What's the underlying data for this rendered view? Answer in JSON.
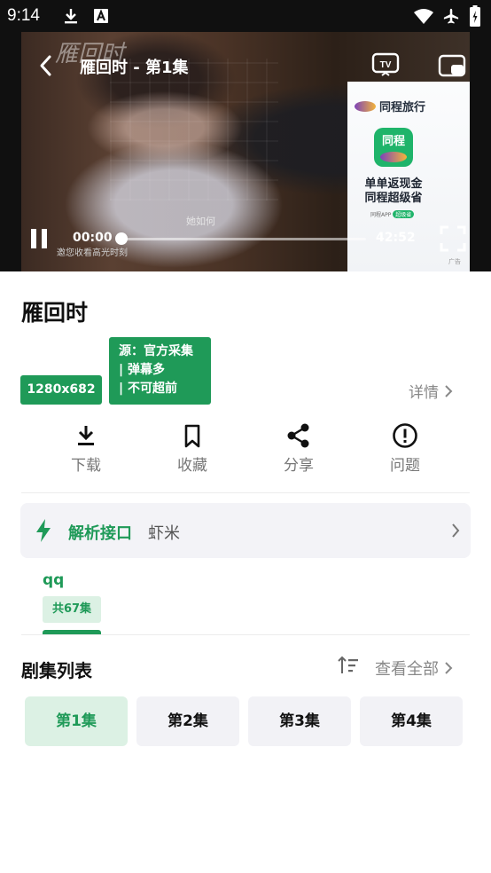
{
  "status_bar": {
    "time": "9:14",
    "icons": [
      "download-icon",
      "a-icon",
      "wifi-icon",
      "airplane-icon",
      "battery-icon"
    ]
  },
  "player": {
    "title": "雁回时 - 第1集",
    "current_time": "00:00",
    "duration": "42:52",
    "progress": 0.01,
    "subtitle": "她如何",
    "hint": "邀您收看高光时刻",
    "watermark": "雁回时"
  },
  "ad": {
    "brand": "同程旅行",
    "logo_text": "同程",
    "line1": "单单返现金",
    "line2": "同程超级省",
    "foot": "同程APP",
    "foot_pill": "超级省",
    "tag": "广告"
  },
  "show": {
    "title": "雁回时",
    "resolution": "1280x682",
    "source_lines": [
      "源：官方采集",
      "| 弹幕多",
      "| 不可超前"
    ],
    "details_label": "详情"
  },
  "actions": [
    {
      "label": "下载",
      "icon": "download-icon"
    },
    {
      "label": "收藏",
      "icon": "bookmark-icon"
    },
    {
      "label": "分享",
      "icon": "share-icon"
    },
    {
      "label": "问题",
      "icon": "alert-icon"
    }
  ],
  "parser": {
    "label": "解析接口",
    "value": "虾米"
  },
  "source": {
    "name": "qq",
    "count": "共67集"
  },
  "episodes": {
    "title": "剧集列表",
    "view_all": "查看全部",
    "items": [
      "第1集",
      "第2集",
      "第3集",
      "第4集"
    ],
    "active_index": 0
  },
  "colors": {
    "accent": "#1f9a58",
    "accent_light": "#dcf1e4",
    "muted_text": "#888888"
  }
}
